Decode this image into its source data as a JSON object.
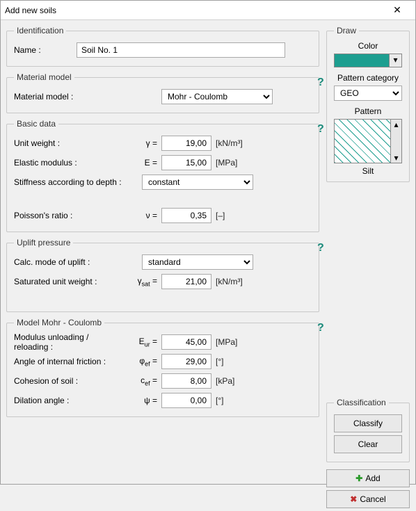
{
  "window": {
    "title": "Add new soils"
  },
  "identification": {
    "legend": "Identification",
    "name_label": "Name :",
    "name_value": "Soil No. 1"
  },
  "material_model": {
    "legend": "Material model",
    "label": "Material model :",
    "value": "Mohr - Coulomb"
  },
  "basic_data": {
    "legend": "Basic data",
    "unit_weight": {
      "label": "Unit weight :",
      "symbol": "γ =",
      "value": "19,00",
      "unit": "[kN/m³]"
    },
    "elastic_modulus": {
      "label": "Elastic modulus :",
      "symbol": "E =",
      "value": "15,00",
      "unit": "[MPa]"
    },
    "stiffness": {
      "label": "Stiffness according to depth :",
      "value": "constant"
    },
    "poisson": {
      "label": "Poisson's ratio :",
      "symbol": "ν =",
      "value": "0,35",
      "unit": "[–]"
    }
  },
  "uplift": {
    "legend": "Uplift pressure",
    "mode": {
      "label": "Calc. mode of uplift :",
      "value": "standard"
    },
    "sat_weight": {
      "label": "Saturated unit weight :",
      "symbol_html": "γ<sub>sat</sub> =",
      "value": "21,00",
      "unit": "[kN/m³]"
    }
  },
  "mohr": {
    "legend": "Model Mohr - Coulomb",
    "eur": {
      "label": "Modulus unloading / reloading :",
      "symbol_html": "E<sub>ur</sub> =",
      "value": "45,00",
      "unit": "[MPa]"
    },
    "phi": {
      "label": "Angle of internal friction :",
      "symbol_html": "φ<sub>ef</sub> =",
      "value": "29,00",
      "unit": "[°]"
    },
    "coh": {
      "label": "Cohesion of soil :",
      "symbol_html": "c<sub>ef</sub> =",
      "value": "8,00",
      "unit": "[kPa]"
    },
    "dil": {
      "label": "Dilation angle :",
      "symbol": "ψ =",
      "value": "0,00",
      "unit": "[°]"
    }
  },
  "draw": {
    "legend": "Draw",
    "color_label": "Color",
    "color_hex": "#1d9e90",
    "pattern_category_label": "Pattern category",
    "pattern_category_value": "GEO",
    "pattern_label": "Pattern",
    "pattern_name": "Silt"
  },
  "classification": {
    "legend": "Classification",
    "classify": "Classify",
    "clear": "Clear"
  },
  "actions": {
    "add": "Add",
    "cancel": "Cancel"
  },
  "help_char": "?"
}
